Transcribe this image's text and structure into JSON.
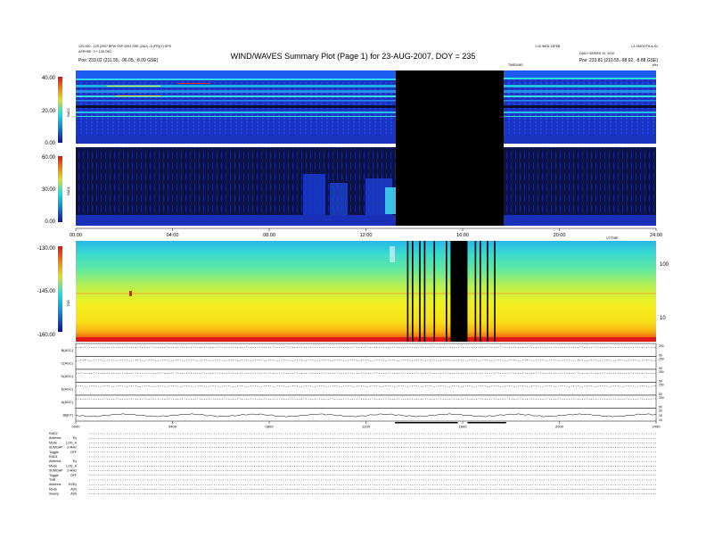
{
  "header": {
    "title": "WIND/WAVES Summary Plot (Page 1) for 23-AUG-2007, DOY = 235",
    "top_left_line1": "12S 000 - 12S [2007 BPW SSP 2003 SSE (2AU) : A (FR)(Y) SPS",
    "top_left_line2": "ASPHSE: 3 + 13S DEC",
    "top_left_pos": "Pos:   233.02 (211.55, -96.05, -8.09 GSE)",
    "top_right_line1": "1:10 WED 23FEB",
    "top_right_line2": "DAILY  SERIES  10, 2010",
    "top_right_pos": "Pos:   233.81 (210.55,-98.62, -8.88 GSE)",
    "top_right_corner": "L2-SMOOTH-a-S1",
    "label_vabs": "TIME/UMS",
    "label_khz": "kHz"
  },
  "panels": {
    "rad2_label": "RAD2",
    "rad1_label": "RAD1",
    "tnr_label": "TNR",
    "rad2_ticks": [
      "40.00",
      "20.00",
      "0.00"
    ],
    "rad1_ticks": [
      "60.00",
      "30.00",
      "0.00"
    ],
    "tnr_ticks": [
      "-130.00",
      "-145.00",
      "-160.00"
    ],
    "tnr_right_ticks": [
      "100",
      "10"
    ],
    "time_ticks": [
      "00:00",
      "04:00",
      "08:00",
      "12:00",
      "16:00",
      "20:00",
      "24:00"
    ],
    "time_ticks_bottom": [
      "0000",
      "0400",
      "0800",
      "1200",
      "1600",
      "2000",
      "2400"
    ],
    "uttime_label": "UT/TIME",
    "colors": {
      "band_blue": "#1c3cdc",
      "dark_navy": "#0a1048",
      "tnr_red": "#e01010",
      "tnr_yellow": "#f8f020",
      "tnr_cyan": "#28d8d8",
      "black": "#000000"
    }
  },
  "lines": [
    {
      "label": "B(AGC)",
      "ticks": [
        "250",
        "50"
      ]
    },
    {
      "label": "C(AGC)",
      "ticks": [
        "250",
        "50"
      ]
    },
    {
      "label": "D(AGC)",
      "ticks": [
        "250",
        "50"
      ]
    },
    {
      "label": "E(AGC)",
      "ticks": [
        "250",
        "50"
      ]
    },
    {
      "label": "A(AGC)",
      "ticks": [
        "250",
        "50"
      ]
    },
    {
      "label": "|B|(nT)",
      "ticks": [
        "20",
        "15",
        "10"
      ]
    }
  ],
  "footer": [
    {
      "k": "RAD2",
      "v": ""
    },
    {
      "k": "Antenna",
      "v": "Ey"
    },
    {
      "k": "Mode",
      "v": "LOG_A"
    },
    {
      "k": "SUMGAP",
      "v": "3.4kHz"
    },
    {
      "k": "Toggle",
      "v": "OFF"
    },
    {
      "k": "RAD1",
      "v": ""
    },
    {
      "k": "Antenna",
      "v": "Ey"
    },
    {
      "k": "Mode",
      "v": "LOG_A"
    },
    {
      "k": "SUMGAP",
      "v": "3.4kHz"
    },
    {
      "k": "Toggle",
      "v": "OFF"
    },
    {
      "k": "TNR",
      "v": ""
    },
    {
      "k": "Antenna",
      "v": "Ex/Ey"
    },
    {
      "k": "Mode",
      "v": "A(0)"
    },
    {
      "k": "Sweep",
      "v": "A(0)"
    }
  ],
  "chart_data": {
    "type": "heatmap",
    "title": "WIND/WAVES Summary Plot (Page 1) for 23-AUG-2007, DOY = 235",
    "x_range_hours": [
      0,
      24
    ],
    "data_gaps_hours": [
      [
        13.2,
        17.6
      ]
    ],
    "tnr_dropout_hours": [
      13.7,
      13.9,
      14.2,
      14.4,
      14.8,
      15.3,
      15.5,
      15.9,
      16.5,
      16.7,
      17.0,
      17.3
    ],
    "panels": [
      {
        "name": "RAD2",
        "ylim": [
          0,
          40
        ],
        "ticks": [
          0,
          20,
          40
        ]
      },
      {
        "name": "RAD1",
        "ylim": [
          0,
          60
        ],
        "ticks": [
          0,
          30,
          60
        ]
      },
      {
        "name": "TNR",
        "ylim": [
          -160,
          -130
        ],
        "ticks": [
          -160,
          -145,
          -130
        ]
      }
    ]
  }
}
